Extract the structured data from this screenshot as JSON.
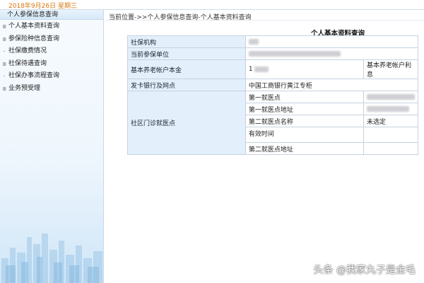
{
  "topbar": {
    "date_text": "2018年9月26日  星期三"
  },
  "sidebar": {
    "header": "个人参保信息查询",
    "items": [
      {
        "label": "个人基本资料查询"
      },
      {
        "label": "参保险种信息查询"
      },
      {
        "label": "社保缴费情况"
      },
      {
        "label": "社保待遇查询"
      },
      {
        "label": "社保办事流程查询"
      },
      {
        "label": "业务预受理"
      }
    ]
  },
  "main": {
    "breadcrumb": "当前位置->>个人参保信息查询-个人基本资料查询",
    "title": "个人基本资料查询",
    "rows": {
      "agency_label": "社保机构",
      "employer_label": "当前参保单位",
      "pension_principal_label": "基本养老帐户本金",
      "pension_principal_value": "1",
      "pension_interest_label": "基本养老帐户利息",
      "bank_label": "发卡银行及网点",
      "bank_value": "中国工商银行黄江专柜",
      "clinic_group_label": "社区门诊就医点",
      "first_clinic_label": "第一就医点",
      "first_clinic_address_label": "第一就医点地址",
      "second_clinic_name_label": "第二就医点名称",
      "second_clinic_name_value": "未选定",
      "valid_time_label": "有效时间",
      "second_clinic_address_label": "第二就医点地址"
    }
  },
  "watermark": "头条 @我家丸子是金毛",
  "colors": {
    "date": "#d9750f",
    "label_bg": "#e3f0fb",
    "border": "#c5d3df"
  }
}
